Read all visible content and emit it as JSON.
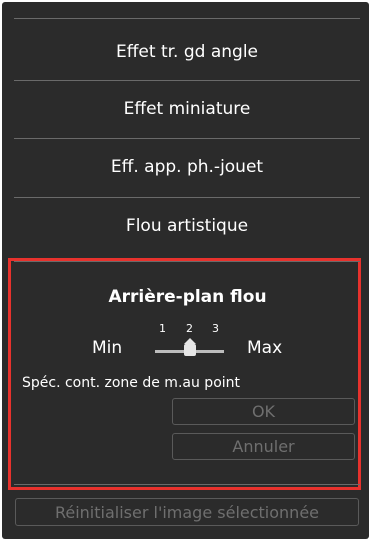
{
  "menu": {
    "items": [
      {
        "label": "Effet tr. gd angle"
      },
      {
        "label": "Effet miniature"
      },
      {
        "label": "Eff. app. ph.-jouet"
      },
      {
        "label": "Flou artistique"
      }
    ]
  },
  "blur_section": {
    "title": "Arrière-plan flou",
    "slider": {
      "min_label": "Min",
      "max_label": "Max",
      "ticks": [
        "1",
        "2",
        "3"
      ],
      "value": "2"
    },
    "description": "Spéc. cont. zone de m.au point",
    "ok_label": "OK",
    "cancel_label": "Annuler"
  },
  "footer": {
    "reset_label": "Réinitialiser l'image sélectionnée"
  },
  "colors": {
    "panel_bg": "#2b2b2b",
    "highlight": "#e8322d",
    "disabled_text": "#6f6f6f"
  }
}
